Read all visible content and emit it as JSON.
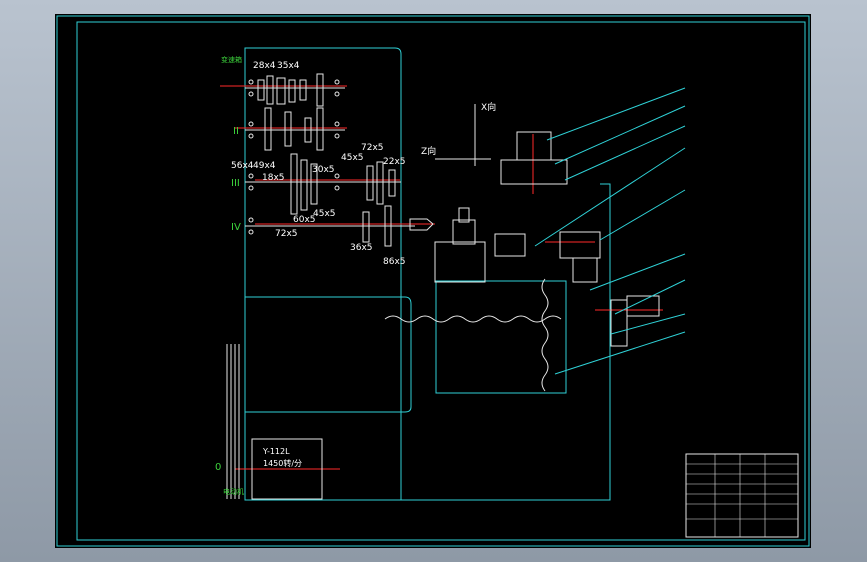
{
  "shaft_labels": [
    "II",
    "III",
    "IV",
    "0"
  ],
  "gear_labels": [
    "28x4",
    "35x4",
    "56x4",
    "49x4",
    "18x5",
    "30x5",
    "45x5",
    "72x5",
    "22x5",
    "60x5",
    "45x5",
    "72x5",
    "36x5",
    "86x5"
  ],
  "axis_labels": {
    "x_dir": "X向",
    "z_dir": "Z向"
  },
  "motor_label": {
    "line1": "Y-112L",
    "line2": "1450转/分"
  },
  "motor_tag": "电动机",
  "top_tag": "变速箱"
}
